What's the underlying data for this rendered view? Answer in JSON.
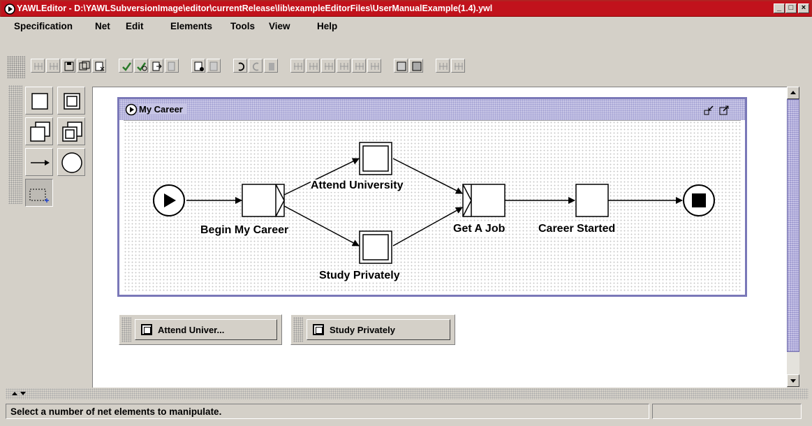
{
  "window": {
    "title": "YAWLEditor - D:\\YAWLSubversionImage\\editor\\currentRelease\\lib\\exampleEditorFiles\\UserManualExample(1.4).ywl",
    "controls": {
      "minimize": "_",
      "maximize": "□",
      "close": "×"
    }
  },
  "menu": {
    "items": [
      {
        "label": "Specification",
        "mnemonic": "S"
      },
      {
        "label": "Net",
        "mnemonic": "N"
      },
      {
        "label": "Edit",
        "mnemonic": "E"
      },
      {
        "label": "Elements",
        "mnemonic": "E"
      },
      {
        "label": "Tools",
        "mnemonic": "T"
      },
      {
        "label": "View",
        "mnemonic": "V"
      },
      {
        "label": "Help",
        "mnemonic": "H"
      }
    ]
  },
  "toolbar": {
    "buttons": [
      "new-spec-icon",
      "open-spec-icon",
      "save-spec-icon",
      "save-as-icon",
      "close-spec-icon",
      "validate-icon",
      "analyse-icon",
      "export-icon",
      "import-icon",
      "new-net-icon",
      "remove-net-icon",
      "undo-icon",
      "redo-icon",
      "delete-icon",
      "align-top-icon",
      "align-middle-icon",
      "align-bottom-icon",
      "align-left-icon",
      "align-center-icon",
      "align-right-icon",
      "zoom-icon",
      "zoom-selected-icon",
      "add-visible-icon",
      "remove-visible-icon"
    ]
  },
  "palette": {
    "tools": [
      "atomic-task-icon",
      "composite-task-icon",
      "multiple-atomic-task-icon",
      "multiple-composite-task-icon",
      "flow-relation-icon",
      "condition-icon",
      "marquee-select-icon"
    ],
    "selected": "marquee-select-icon"
  },
  "net": {
    "title": "My Career",
    "tasks": {
      "begin": "Begin My Career",
      "attend": "Attend University",
      "study": "Study Privately",
      "job": "Get A Job",
      "started": "Career Started"
    }
  },
  "minimized": [
    {
      "label": "Attend Univer..."
    },
    {
      "label": "Study Privately"
    }
  ],
  "status": {
    "message": "Select a number of net elements to manipulate.",
    "secondary": ""
  },
  "colors": {
    "titlebar": "#c1121c",
    "frame": "#7a78b8",
    "chrome": "#d4d0c8"
  }
}
